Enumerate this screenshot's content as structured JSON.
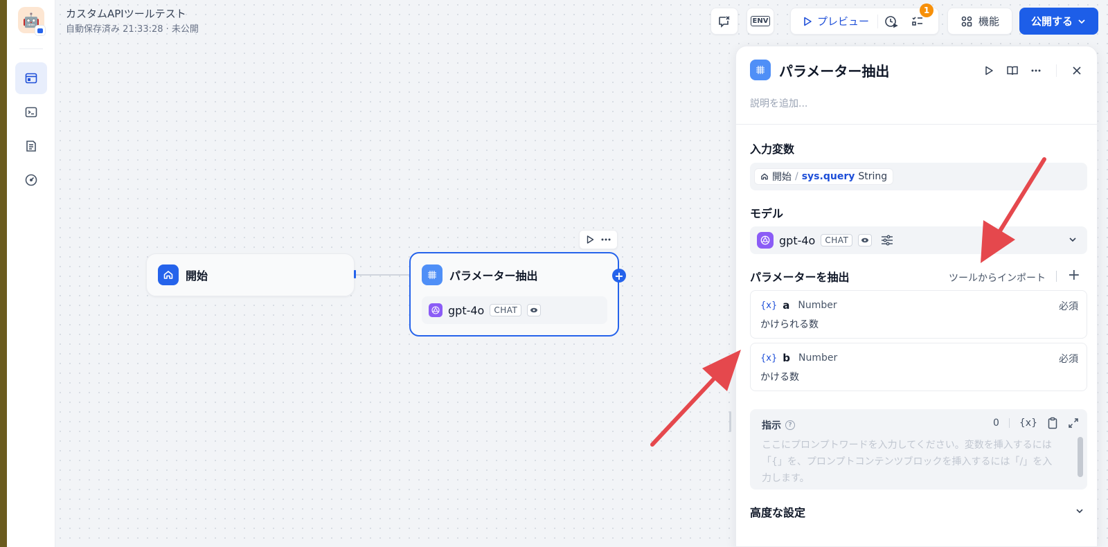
{
  "workflow": {
    "title": "カスタムAPIツールテスト",
    "status": "自動保存済み 21:33:28 · 未公開"
  },
  "toolbar": {
    "env_label": "ENV",
    "preview_label": "プレビュー",
    "checklist_badge": "1",
    "features_label": "機能",
    "publish_label": "公開する"
  },
  "canvas": {
    "start_node": {
      "title": "開始"
    },
    "param_node": {
      "title": "パラメーター抽出",
      "model": "gpt-4o",
      "model_mode": "CHAT"
    }
  },
  "panel": {
    "title": "パラメーター抽出",
    "description_placeholder": "説明を追加...",
    "input_section": "入力変数",
    "input_var": {
      "source": "開始",
      "name": "sys.query",
      "type": "String"
    },
    "model_section": "モデル",
    "model": {
      "name": "gpt-4o",
      "mode": "CHAT"
    },
    "extract_section": "パラメーターを抽出",
    "import_link": "ツールからインポート",
    "params": [
      {
        "name": "a",
        "type": "Number",
        "required": "必須",
        "description": "かけられる数"
      },
      {
        "name": "b",
        "type": "Number",
        "required": "必須",
        "description": "かける数"
      }
    ],
    "instruction": {
      "label": "指示",
      "count": "0",
      "placeholder": "ここにプロンプトワードを入力してください。変数を挿入するには「{」を、プロンプトコンテンツブロックを挿入するには「/」を入力します。"
    },
    "advanced_section": "高度な設定"
  },
  "colors": {
    "accent": "#1d5ee8",
    "annotation_arrow": "#e5484d",
    "badge": "#f79009",
    "openai_purple": "#8b5cf6"
  }
}
